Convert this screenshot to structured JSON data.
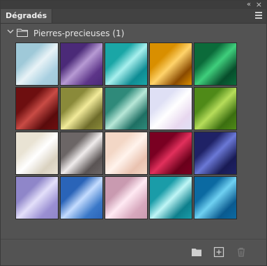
{
  "panel": {
    "tab_label": "Dégradés",
    "collapse_glyph": "«",
    "close_glyph": "×",
    "group": {
      "label": "Pierres-precieuses (1)"
    }
  },
  "swatches": [
    {
      "c1": "#9fc9d8",
      "c2": "#e8f3f7",
      "c3": "#a9cfe0"
    },
    {
      "c1": "#4b2a78",
      "c2": "#b79ad4",
      "c3": "#5d3589"
    },
    {
      "c1": "#1aa6a6",
      "c2": "#a8f0ee",
      "c3": "#0e8c94"
    },
    {
      "c1": "#d98f00",
      "c2": "#ffd36a",
      "c3": "#8a4a00"
    },
    {
      "c1": "#0b6b3a",
      "c2": "#3fcf7c",
      "c3": "#074d2b"
    },
    {
      "c1": "#6e0f10",
      "c2": "#c94b45",
      "c3": "#5a0b0c"
    },
    {
      "c1": "#8a8a3a",
      "c2": "#f2eb9a",
      "c3": "#6e6c2a"
    },
    {
      "c1": "#2f8a7a",
      "c2": "#b8e8d8",
      "c3": "#1e6f63"
    },
    {
      "c1": "#dfe0f5",
      "c2": "#ffffff",
      "c3": "#e8d8ef"
    },
    {
      "c1": "#4f8a18",
      "c2": "#b6dd5a",
      "c3": "#3b6e10"
    },
    {
      "c1": "#e9e3d4",
      "c2": "#ffffff",
      "c3": "#d9d1c0"
    },
    {
      "c1": "#6c6666",
      "c2": "#f0ecec",
      "c3": "#5a5454"
    },
    {
      "c1": "#f3d7c6",
      "c2": "#fff3ec",
      "c3": "#e9c2b0"
    },
    {
      "c1": "#7a0022",
      "c2": "#e2305c",
      "c3": "#6a001b"
    },
    {
      "c1": "#1f2266",
      "c2": "#6a78d6",
      "c3": "#191b55"
    },
    {
      "c1": "#8f86c9",
      "c2": "#e4e0fa",
      "c3": "#9a8fd2"
    },
    {
      "c1": "#2a64b8",
      "c2": "#c4dcff",
      "c3": "#3a78c8"
    },
    {
      "c1": "#c99ab0",
      "c2": "#ffeaf3",
      "c3": "#d7a8bd"
    },
    {
      "c1": "#1a9ca8",
      "c2": "#bff6f6",
      "c3": "#0d7f8c"
    },
    {
      "c1": "#0b6aa2",
      "c2": "#6fd1f2",
      "c3": "#0a5a8f"
    }
  ]
}
